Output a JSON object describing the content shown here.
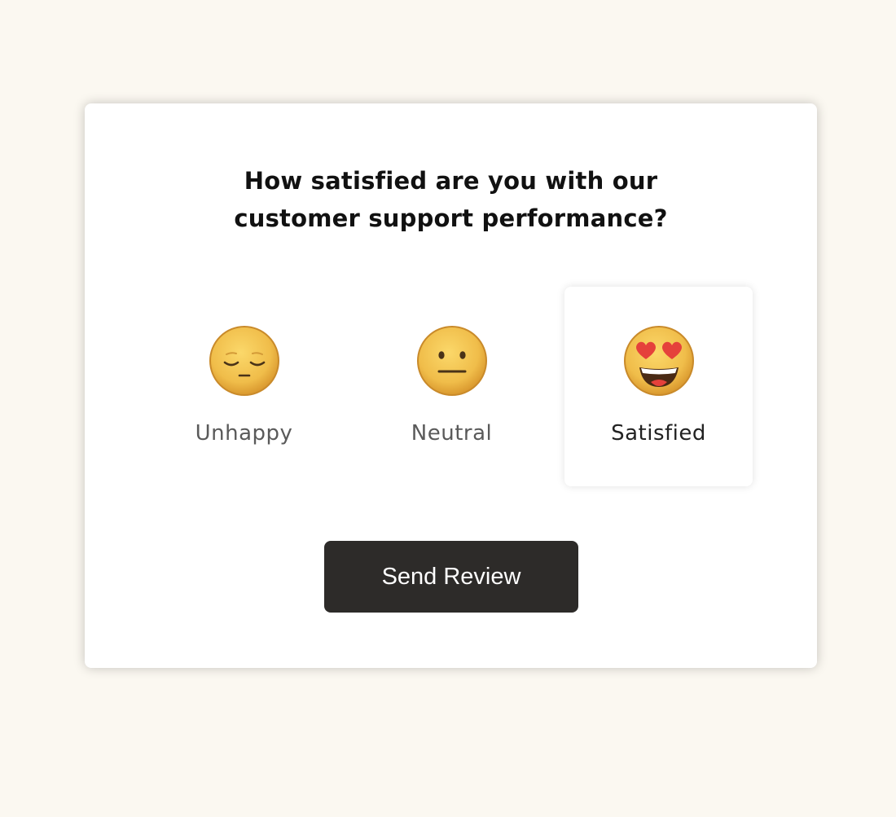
{
  "survey": {
    "question_line1": "How satisfied are you with our",
    "question_line2": "customer support performance?",
    "options": [
      {
        "label": "Unhappy",
        "icon": "pensive-face-icon",
        "selected": false
      },
      {
        "label": "Neutral",
        "icon": "neutral-face-icon",
        "selected": false
      },
      {
        "label": "Satisfied",
        "icon": "heart-eyes-face-icon",
        "selected": true
      }
    ],
    "submit_label": "Send Review"
  },
  "colors": {
    "page_background": "#fbf8f1",
    "card_background": "#ffffff",
    "button_background": "#2d2b29",
    "button_text": "#ffffff",
    "emoji_face": "#f2c04e",
    "heart": "#e5413b"
  }
}
